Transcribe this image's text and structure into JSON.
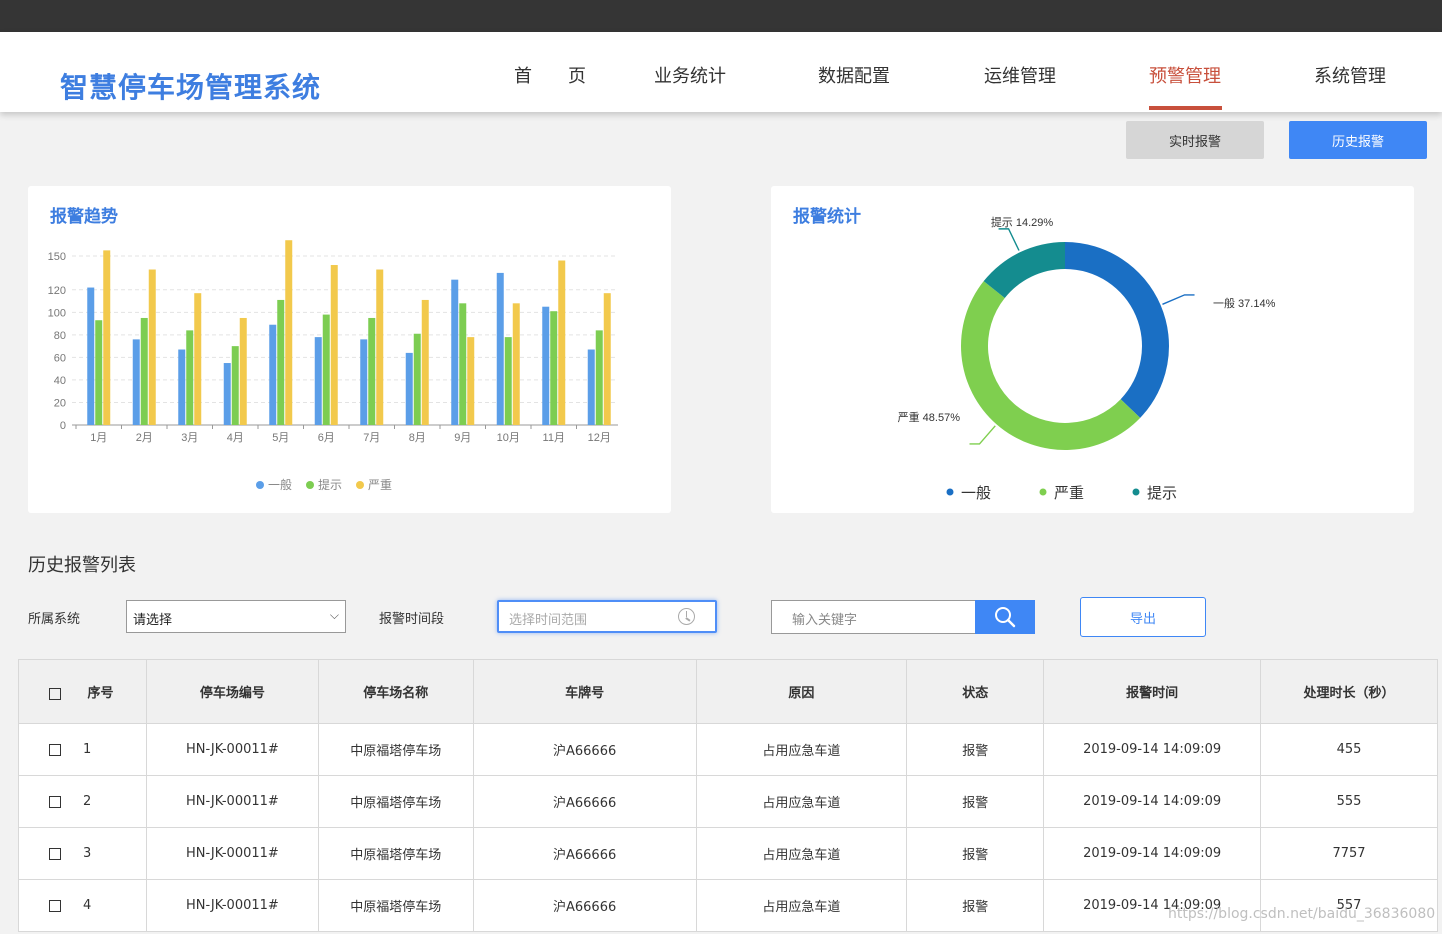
{
  "app": {
    "title": "智慧停车场管理系统"
  },
  "nav": [
    {
      "label": "首　　页",
      "active": false
    },
    {
      "label": "业务统计",
      "active": false
    },
    {
      "label": "数据配置",
      "active": false
    },
    {
      "label": "运维管理",
      "active": false
    },
    {
      "label": "预警管理",
      "active": true
    },
    {
      "label": "系统管理",
      "active": false
    }
  ],
  "actions": {
    "realtime_label": "实时报警",
    "history_label": "历史报警"
  },
  "trend_card": {
    "title": "报警趋势"
  },
  "stats_card": {
    "title": "报警统计"
  },
  "colors": {
    "series1": "#5b9ee8",
    "series2": "#7dcd52",
    "series3": "#f2c94c",
    "pie_general": "#1a6fc4",
    "pie_severe": "#7fcf4f",
    "pie_hint": "#148c8f",
    "accent": "#3f87f5",
    "active_nav": "#c8503c"
  },
  "chart_data": [
    {
      "type": "bar",
      "title": "报警趋势",
      "categories": [
        "1月",
        "2月",
        "3月",
        "4月",
        "5月",
        "6月",
        "7月",
        "8月",
        "9月",
        "10月",
        "11月",
        "12月"
      ],
      "series": [
        {
          "name": "一般",
          "values": [
            122,
            76,
            67,
            55,
            89,
            78,
            76,
            64,
            129,
            135,
            105,
            67
          ]
        },
        {
          "name": "提示",
          "values": [
            93,
            95,
            84,
            70,
            111,
            98,
            95,
            81,
            108,
            78,
            101,
            84
          ]
        },
        {
          "name": "严重",
          "values": [
            155,
            138,
            117,
            95,
            164,
            142,
            138,
            111,
            78,
            108,
            146,
            117
          ]
        }
      ],
      "yticks": [
        0,
        20,
        40,
        60,
        80,
        100,
        120,
        150
      ],
      "grid": true,
      "legend": "bottom"
    },
    {
      "type": "pie",
      "title": "报警统计",
      "slices": [
        {
          "name": "一般",
          "label": "一般 37.14%",
          "value": 37.14
        },
        {
          "name": "严重",
          "label": "严重 48.57%",
          "value": 48.57
        },
        {
          "name": "提示",
          "label": "提示 14.29%",
          "value": 14.29
        }
      ],
      "donut": true,
      "legend": "bottom"
    }
  ],
  "list": {
    "title": "历史报警列表",
    "filter_system_label": "所属系统",
    "filter_system_value": "请选择",
    "filter_time_label": "报警时间段",
    "time_placeholder": "选择时间范围",
    "search_placeholder": "输入关键字",
    "export_label": "导出",
    "columns": [
      "序号",
      "停车场编号",
      "停车场名称",
      "车牌号",
      "原因",
      "状态",
      "报警时间",
      "处理时长（秒）"
    ],
    "rows": [
      [
        "1",
        "HN-JK-00011#",
        "中原福塔停车场",
        "沪A66666",
        "占用应急车道",
        "报警",
        "2019-09-14 14:09:09",
        "455"
      ],
      [
        "2",
        "HN-JK-00011#",
        "中原福塔停车场",
        "沪A66666",
        "占用应急车道",
        "报警",
        "2019-09-14 14:09:09",
        "555"
      ],
      [
        "3",
        "HN-JK-00011#",
        "中原福塔停车场",
        "沪A66666",
        "占用应急车道",
        "报警",
        "2019-09-14 14:09:09",
        "7757"
      ],
      [
        "4",
        "HN-JK-00011#",
        "中原福塔停车场",
        "沪A66666",
        "占用应急车道",
        "报警",
        "2019-09-14 14:09:09",
        "557"
      ]
    ]
  },
  "watermark": "https://blog.csdn.net/baidu_36836080"
}
